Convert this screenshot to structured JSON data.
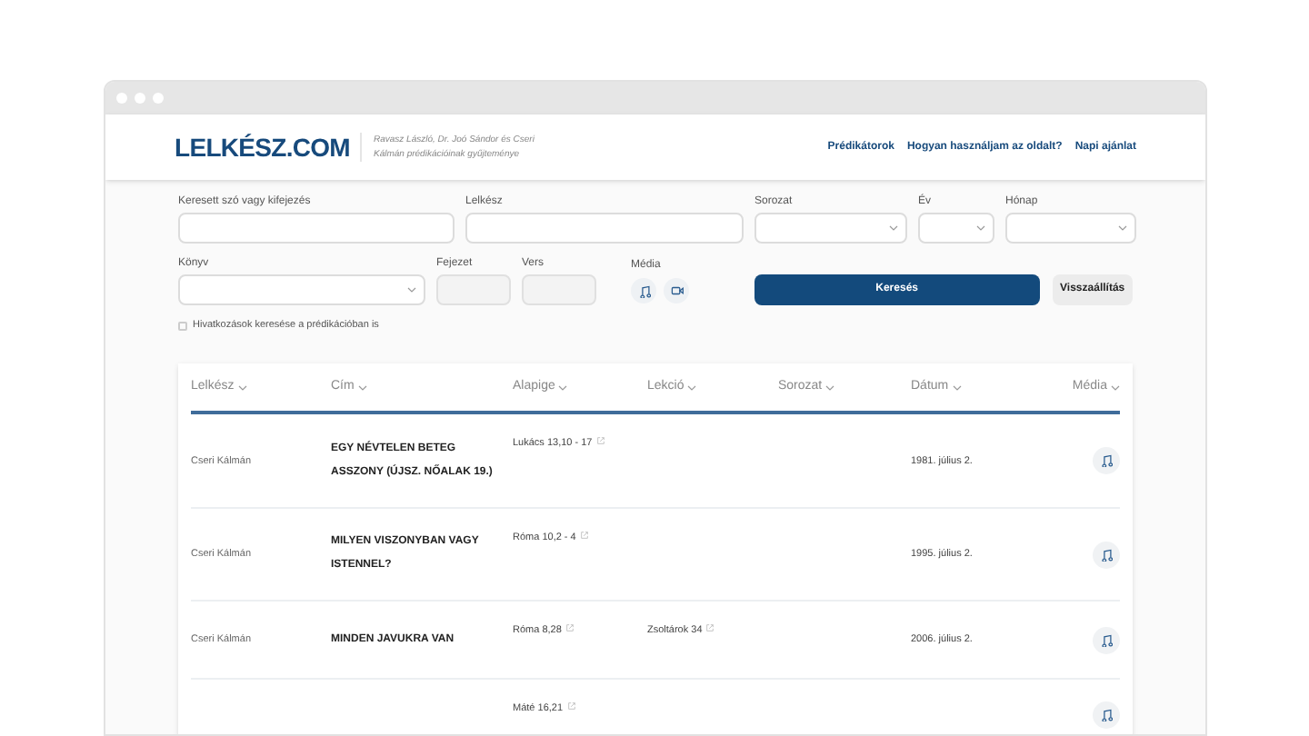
{
  "header": {
    "logo": "LELKÉSZ.COM",
    "tagline": "Ravasz László, Dr. Joó Sándor és Cseri Kálmán prédikációinak gyűjteménye",
    "nav": [
      "Prédikátorok",
      "Hogyan használjam az oldalt?",
      "Napi ajánlat"
    ]
  },
  "search": {
    "fields": [
      {
        "label": "Keresett szó vagy kifejezés",
        "kind": "text"
      },
      {
        "label": "Lelkész",
        "kind": "text"
      },
      {
        "label": "Sorozat",
        "kind": "select"
      },
      {
        "label": "Év",
        "kind": "select"
      },
      {
        "label": "Hónap",
        "kind": "select"
      }
    ],
    "fields_row2": [
      {
        "label": "Könyv",
        "kind": "select"
      },
      {
        "label": "Fejezet",
        "kind": "disabled"
      },
      {
        "label": "Vers",
        "kind": "disabled"
      }
    ],
    "media_label": "Média",
    "media_filters": [
      {
        "kind": "audio",
        "selected": false
      },
      {
        "kind": "video",
        "selected": false
      }
    ],
    "search_button": "Keresés",
    "reset_button": "Visszaállítás",
    "checkbox": {
      "label": "Hivatkozások keresése a prédikációban is",
      "checked": false
    }
  },
  "table": {
    "columns": [
      "Lelkész",
      "Cím",
      "Alapige",
      "Lekció",
      "Sorozat",
      "Dátum",
      "Média"
    ],
    "rows": [
      {
        "lelkesz": "Cseri Kálmán",
        "cim": "EGY NÉVTELEN BETEG ASSZONY (ÚJSZ. NŐALAK 19.)",
        "alapige": "Lukács 13,10 - 17",
        "datum": "1981. július 2.",
        "kind": "audio"
      },
      {
        "lelkesz": "Cseri Kálmán",
        "cim": "MILYEN VISZONYBAN VAGY ISTENNEL?",
        "alapige": "Róma 10,2 - 4",
        "datum": "1995. július 2.",
        "kind": "audio"
      },
      {
        "lelkesz": "Cseri Kálmán",
        "cim": "MINDEN JAVUKRA VAN",
        "alapige": "Róma 8,28",
        "lekcio": "Zsoltárok 34",
        "datum": "2006. július 2.",
        "kind": "audio"
      },
      {
        "alapige": "Máté 16,21",
        "kind": "audio"
      }
    ]
  }
}
